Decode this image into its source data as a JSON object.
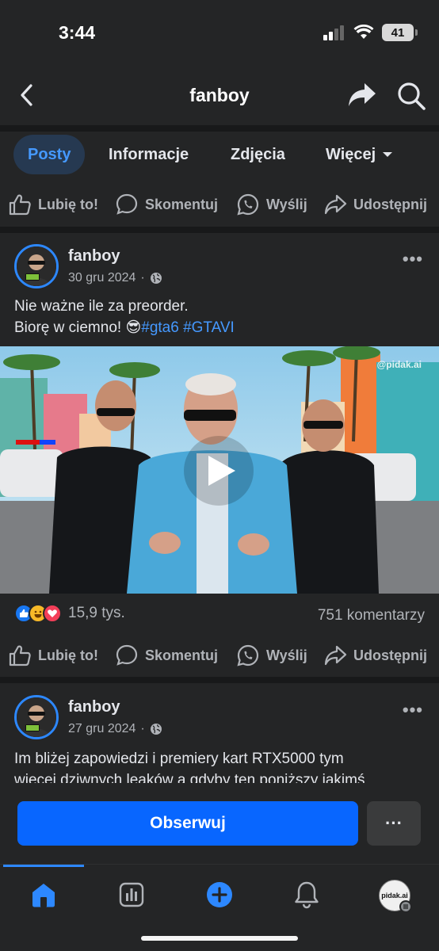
{
  "status": {
    "time": "3:44",
    "battery": "41"
  },
  "header": {
    "title": "fanboy"
  },
  "tabs": [
    {
      "label": "Posty",
      "active": true
    },
    {
      "label": "Informacje",
      "active": false
    },
    {
      "label": "Zdjęcia",
      "active": false
    },
    {
      "label": "Więcej",
      "active": false
    }
  ],
  "actions": {
    "like": "Lubię to!",
    "comment": "Skomentuj",
    "send": "Wyślij",
    "share": "Udostępnij"
  },
  "posts": [
    {
      "author": "fanboy",
      "date": "30 gru 2024",
      "text_line1": "Nie ważne ile za preorder.",
      "text_line2": "Biorę w ciemno! 😎",
      "hashtag1": "#gta6",
      "hashtag2": "#GTAVI",
      "watermark": "@pidak.ai",
      "reaction_count": "15,9 tys.",
      "comment_count": "751 komentarzy"
    },
    {
      "author": "fanboy",
      "date": "27 gru 2024",
      "text_line1": "Im bliżej zapowiedzi i premiery  kart RTX5000 tym",
      "text_line2": "więcej dziwnych leaków a gdyby ten poniższy jakimś"
    }
  ],
  "bottom": {
    "follow": "Obserwuj",
    "more": "···"
  },
  "tabbar": {
    "avatar_label": "pidak.ai"
  },
  "colors": {
    "accent": "#0866ff",
    "link": "#4599ff",
    "background": "#242526"
  }
}
